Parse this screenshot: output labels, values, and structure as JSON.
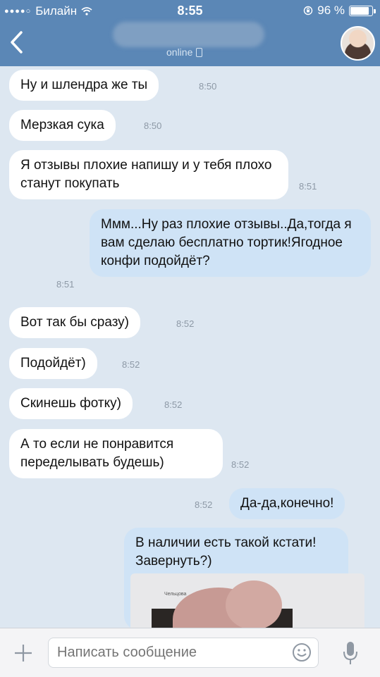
{
  "statusbar": {
    "carrier": "Билайн",
    "time": "8:55",
    "battery": "96 %",
    "battery_level": 0.96
  },
  "header": {
    "status": "online"
  },
  "messages": [
    {
      "text": "Ну и шлендра же ты",
      "time": "8:50"
    },
    {
      "text": "Мерзкая сука",
      "time": "8:50"
    },
    {
      "text": "Я отзывы плохие напишу и у тебя плохо станут покупать",
      "time": "8:51"
    },
    {
      "text": "Ммм...Ну раз плохие отзывы..Да,тогда я вам сделаю бесплатно тортик!Ягодное конфи подойдёт?",
      "time": "8:51"
    },
    {
      "text": "Вот так бы сразу)",
      "time": "8:52"
    },
    {
      "text": "Подойдёт)",
      "time": "8:52"
    },
    {
      "text": "Скинешь фотку)",
      "time": "8:52"
    },
    {
      "text": "А то если не понравится переделывать будешь)",
      "time": "8:52"
    },
    {
      "text": "Да-да,конечно!",
      "time": "8:52"
    },
    {
      "text": "В наличии есть такой кстати! Завернуть?)",
      "photo_watermark": "Чельцова"
    }
  ],
  "composer": {
    "placeholder": "Написать сообщение"
  },
  "colors": {
    "header": "#5b87b6",
    "chat_bg": "#dde7f1",
    "incoming": "#ffffff",
    "outgoing": "#cfe3f6"
  }
}
